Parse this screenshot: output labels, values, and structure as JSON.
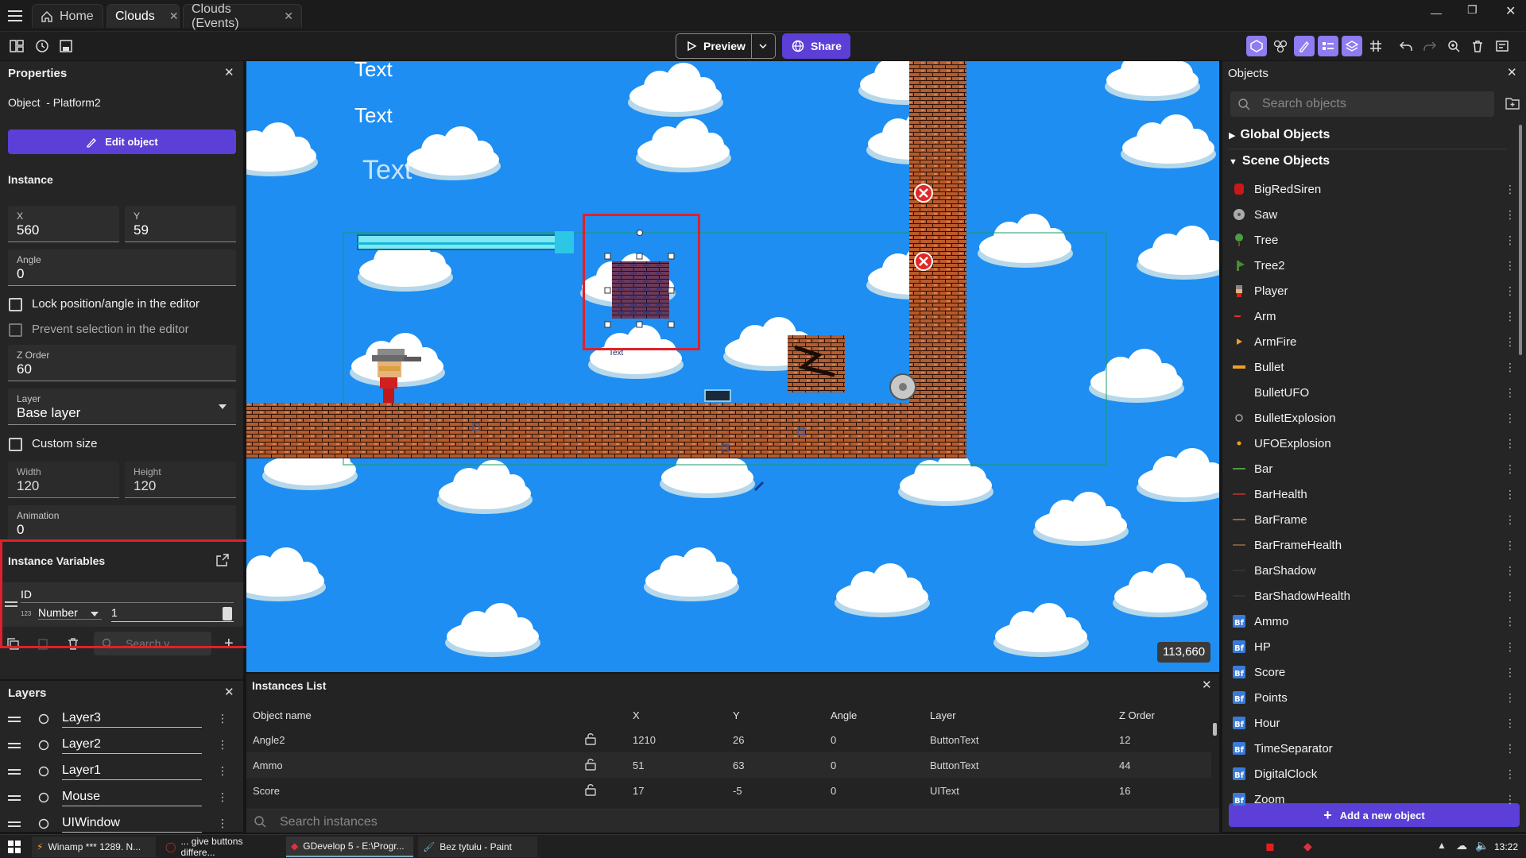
{
  "tabs": {
    "home": "Home",
    "clouds": "Clouds",
    "events": "Clouds (Events)"
  },
  "toolbar": {
    "preview": "Preview",
    "share": "Share"
  },
  "properties": {
    "title": "Properties",
    "object_label": "Object  - Platform2",
    "edit_button": "Edit object",
    "instance_heading": "Instance",
    "x_label": "X",
    "x_value": "560",
    "y_label": "Y",
    "y_value": "59",
    "angle_label": "Angle",
    "angle_value": "0",
    "lock_label": "Lock position/angle in the editor",
    "prevent_label": "Prevent selection in the editor",
    "zorder_label": "Z Order",
    "zorder_value": "60",
    "layer_label": "Layer",
    "layer_value": "Base layer",
    "custom_size_label": "Custom size",
    "width_label": "Width",
    "width_value": "120",
    "height_label": "Height",
    "height_value": "120",
    "animation_label": "Animation",
    "animation_value": "0",
    "inst_vars_title": "Instance Variables",
    "var_name": "ID",
    "var_type_prefix": "123",
    "var_type": "Number",
    "var_value": "1",
    "search_placeholder": "Search v"
  },
  "layers": {
    "title": "Layers",
    "items": [
      "Layer3",
      "Layer2",
      "Layer1",
      "Mouse",
      "UIWindow"
    ]
  },
  "scene": {
    "texts": [
      "Text",
      "Text",
      "Text"
    ],
    "small_text": "Text",
    "coords": "113,660"
  },
  "instances": {
    "title": "Instances List",
    "headers": [
      "Object name",
      "X",
      "Y",
      "Angle",
      "Layer",
      "Z Order"
    ],
    "rows": [
      [
        "Angle2",
        "1210",
        "26",
        "0",
        "ButtonText",
        "12"
      ],
      [
        "Ammo",
        "51",
        "63",
        "0",
        "ButtonText",
        "44"
      ],
      [
        "Score",
        "17",
        "-5",
        "0",
        "UIText",
        "16"
      ]
    ],
    "search_placeholder": "Search instances"
  },
  "objects": {
    "title": "Objects",
    "search_placeholder": "Search objects",
    "global": "Global Objects",
    "scene": "Scene Objects",
    "items": [
      "BigRedSiren",
      "Saw",
      "Tree",
      "Tree2",
      "Player",
      "Arm",
      "ArmFire",
      "Bullet",
      "BulletUFO",
      "BulletExplosion",
      "UFOExplosion",
      "Bar",
      "BarHealth",
      "BarFrame",
      "BarFrameHealth",
      "BarShadow",
      "BarShadowHealth",
      "Ammo",
      "HP",
      "Score",
      "Points",
      "Hour",
      "TimeSeparator",
      "DigitalClock",
      "Zoom"
    ],
    "add_button": "Add a new object"
  },
  "taskbar": {
    "items": [
      "Winamp *** 1289. N...",
      "... give buttons differe...",
      "GDevelop 5 - E:\\Progr...",
      "Bez tytułu - Paint"
    ],
    "time": "13:22"
  },
  "colors": {
    "accent": "#5b3fd6",
    "sky": "#1e8ef2",
    "highlight": "#e0202a"
  }
}
